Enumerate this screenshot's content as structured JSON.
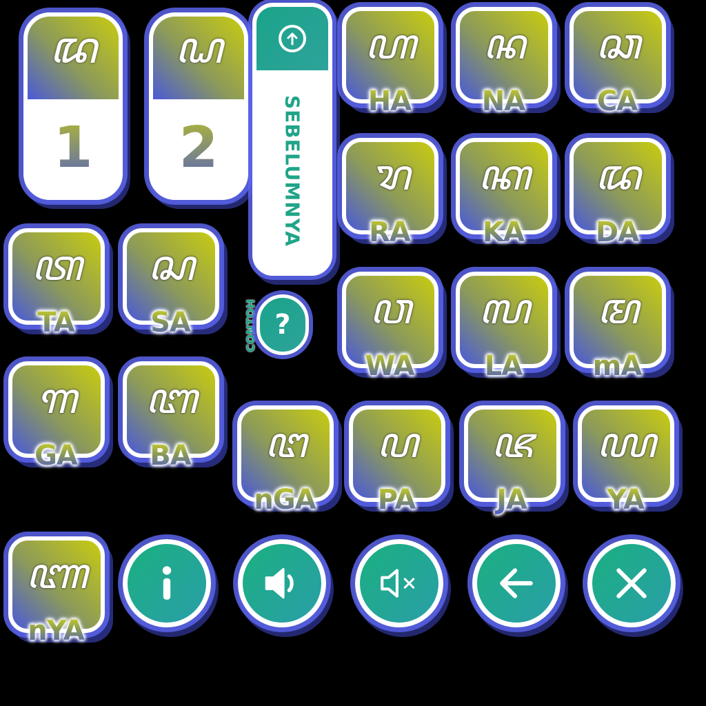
{
  "levels": [
    {
      "glyph": "ꦢ",
      "number": "1"
    },
    {
      "glyph": "ꦝ",
      "number": "2"
    }
  ],
  "prev_button": {
    "label": "SEBELUMNYA",
    "icon": "arrow-up-circle-icon"
  },
  "example_button": {
    "label": "CONTOH",
    "icon": "question-icon"
  },
  "letters": [
    {
      "glyph": "ꦲ",
      "label": "HA"
    },
    {
      "glyph": "ꦤ",
      "label": "NA"
    },
    {
      "glyph": "ꦕ",
      "label": "CA"
    },
    {
      "glyph": "ꦫ",
      "label": "RA"
    },
    {
      "glyph": "ꦏ",
      "label": "KA"
    },
    {
      "glyph": "ꦢ",
      "label": "DA"
    },
    {
      "glyph": "ꦠ",
      "label": "TA"
    },
    {
      "glyph": "ꦱ",
      "label": "SA"
    },
    {
      "glyph": "ꦮ",
      "label": "WA"
    },
    {
      "glyph": "ꦭ",
      "label": "LA"
    },
    {
      "glyph": "ꦩ",
      "label": "mA"
    },
    {
      "glyph": "ꦒ",
      "label": "GA"
    },
    {
      "glyph": "ꦧ",
      "label": "BA"
    },
    {
      "glyph": "ꦔ",
      "label": "nGA"
    },
    {
      "glyph": "ꦥ",
      "label": "PA"
    },
    {
      "glyph": "ꦗ",
      "label": "JA"
    },
    {
      "glyph": "ꦪ",
      "label": "YA"
    },
    {
      "glyph": "ꦚ",
      "label": "nYA"
    }
  ],
  "controls": [
    {
      "name": "info-button",
      "icon": "info-icon"
    },
    {
      "name": "sound-on-button",
      "icon": "speaker-icon"
    },
    {
      "name": "sound-off-button",
      "icon": "mute-icon"
    },
    {
      "name": "back-button",
      "icon": "arrow-left-icon"
    },
    {
      "name": "close-button",
      "icon": "close-icon"
    }
  ],
  "colors": {
    "tile_gradient_start": "#4a5ad8",
    "tile_gradient_end": "#c8cc10",
    "accent_teal": "#1aa38a",
    "outline_blue": "#5a64eb"
  }
}
